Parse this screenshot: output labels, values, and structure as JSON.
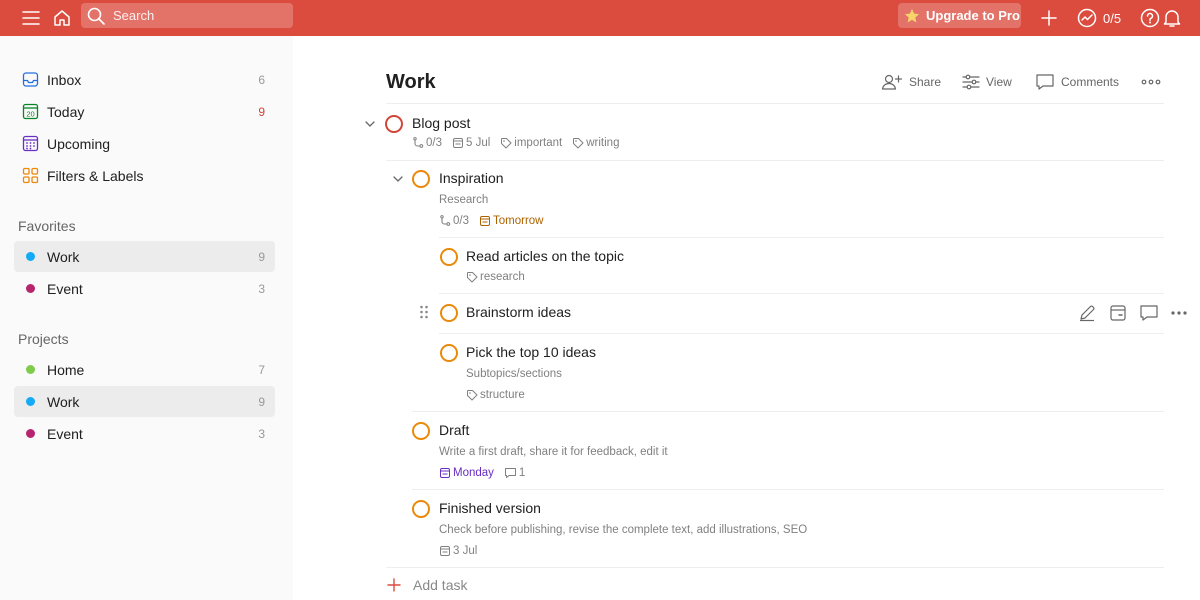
{
  "topbar": {
    "search_placeholder": "Search",
    "upgrade_label": "Upgrade to Pro",
    "karma": "0/5",
    "icons": [
      "menu-icon",
      "home-icon",
      "search-icon",
      "star-icon",
      "plus-icon",
      "productivity-icon",
      "help-icon",
      "bell-icon"
    ]
  },
  "sidebar": {
    "nav": [
      {
        "label": "Inbox",
        "count": "6",
        "icon": "inbox-icon"
      },
      {
        "label": "Today",
        "count": "9",
        "icon": "calendar-today-icon",
        "day": "20"
      },
      {
        "label": "Upcoming",
        "count": "",
        "icon": "calendar-grid-icon"
      },
      {
        "label": "Filters & Labels",
        "count": "",
        "icon": "filters-icon"
      }
    ],
    "favorites_title": "Favorites",
    "favorites": [
      {
        "label": "Work",
        "count": "9",
        "color": "#14aaf5"
      },
      {
        "label": "Event",
        "count": "3",
        "color": "#b8256f"
      }
    ],
    "projects_title": "Projects",
    "projects": [
      {
        "label": "Home",
        "count": "7",
        "color": "#7ecc49"
      },
      {
        "label": "Work",
        "count": "9",
        "color": "#14aaf5"
      },
      {
        "label": "Event",
        "count": "3",
        "color": "#b8256f"
      }
    ]
  },
  "main": {
    "title": "Work",
    "share": "Share",
    "view": "View",
    "comments": "Comments",
    "tasks": {
      "blog": {
        "title": "Blog post",
        "subtasks": "0/3",
        "date": "5 Jul",
        "label1": "important",
        "label2": "writing"
      },
      "inspiration": {
        "title": "Inspiration",
        "desc": "Research",
        "subtasks": "0/3",
        "date": "Tomorrow"
      },
      "read": {
        "title": "Read articles on the topic",
        "label": "research"
      },
      "brainstorm": {
        "title": "Brainstorm ideas"
      },
      "pick": {
        "title": "Pick the top 10 ideas",
        "desc": "Subtopics/sections",
        "label": "structure"
      },
      "draft": {
        "title": "Draft",
        "desc": "Write a first draft, share it for feedback, edit it",
        "date": "Monday",
        "comments": "1"
      },
      "final": {
        "title": "Finished version",
        "desc": "Check before publishing, revise the complete text, add illustrations, SEO",
        "date": "3 Jul"
      }
    },
    "add_task": "Add task"
  },
  "colors": {
    "brand": "#db4c3f",
    "priority_red": "#d1453b",
    "orange": "#eb8909",
    "tomorrow": "#ad6200",
    "monday": "#692ec2"
  }
}
